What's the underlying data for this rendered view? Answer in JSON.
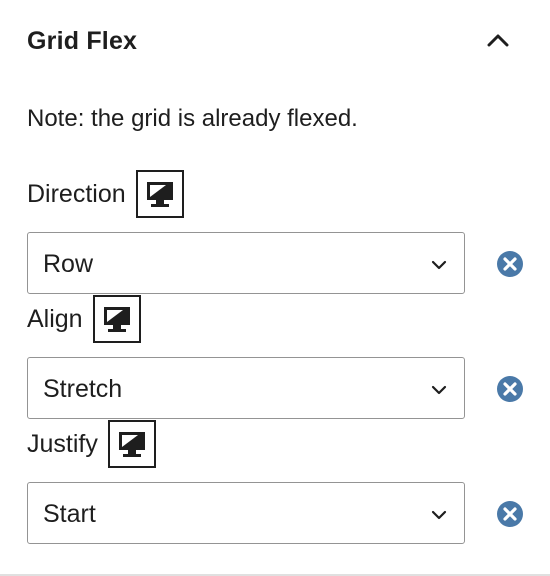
{
  "panel": {
    "title": "Grid Flex",
    "note": "Note: the grid is already flexed."
  },
  "controls": [
    {
      "label": "Direction",
      "value": "Row"
    },
    {
      "label": "Align",
      "value": "Stretch"
    },
    {
      "label": "Justify",
      "value": "Start"
    }
  ],
  "icons": {
    "collapse": "chevron-up-icon",
    "device": "desktop-icon",
    "dropdown": "chevron-down-icon",
    "clear": "clear-circle-icon"
  },
  "colors": {
    "text": "#1e1e1e",
    "select_border": "#949494",
    "clear_icon": "#4a79a8"
  }
}
